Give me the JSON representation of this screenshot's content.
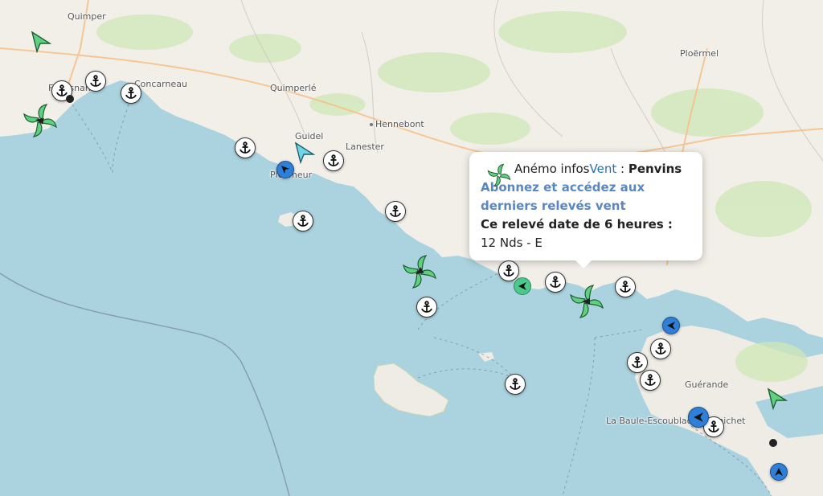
{
  "places": [
    {
      "name": "Quimper"
    },
    {
      "name": "Concarneau"
    },
    {
      "name": "Quimperlé"
    },
    {
      "name": "Guidel"
    },
    {
      "name": "Hennebont"
    },
    {
      "name": "Lanester"
    },
    {
      "name": "Ploemeur"
    },
    {
      "name": "Ploërmel"
    },
    {
      "name": "Guérande"
    },
    {
      "name": "La Baule-Escoublac"
    },
    {
      "name": "Pornichet"
    },
    {
      "name": "Fouesnant"
    }
  ],
  "popup": {
    "prefix": "Anémo infos",
    "brand": "Vent",
    "separator": " : ",
    "station": "Penvins",
    "link": "Abonnez et accédez aux derniers relevés vent",
    "age": "Ce relevé date de 6 heures :",
    "reading": "12 Nds - E"
  },
  "colors": {
    "sea": "#aad3df",
    "land": "#f2efe9",
    "green_wind": "#5fd07f",
    "blue_marker": "#2f7fd8",
    "popup_link": "#5a87c2"
  },
  "markers": {
    "anchor_icon": "anchor-icon",
    "wind_icon": "wind-turbine-icon",
    "arrow_icon": "direction-arrow-icon"
  }
}
